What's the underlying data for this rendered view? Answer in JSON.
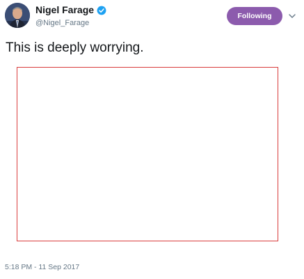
{
  "tweet": {
    "author": {
      "display_name": "Nigel Farage",
      "handle": "@Nigel_Farage",
      "verified": true
    },
    "follow_button_label": "Following",
    "text": "This is deeply worrying.",
    "timestamp": "5:18 PM - 11 Sep 2017"
  },
  "icons": {
    "verified": "verified-badge-icon",
    "menu": "chevron-down-icon"
  },
  "colors": {
    "follow_button_bg": "#8c5bad",
    "verified_blue": "#1da1f2",
    "media_border": "#d83a3a",
    "secondary_text": "#657786"
  }
}
